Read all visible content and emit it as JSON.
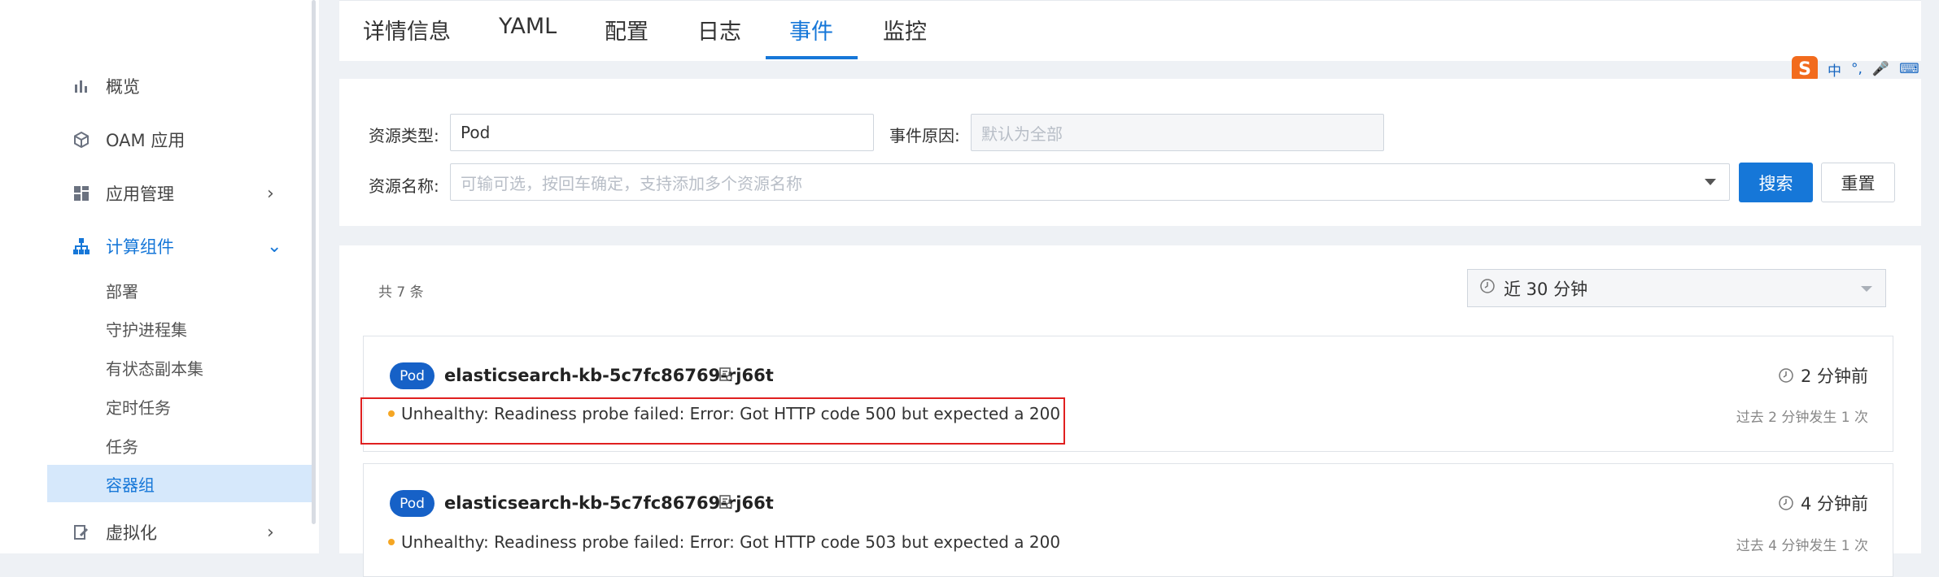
{
  "sidebar": {
    "items": [
      {
        "label": "概览",
        "icon": "bar-chart-icon"
      },
      {
        "label": "OAM 应用",
        "icon": "cube-icon"
      },
      {
        "label": "应用管理",
        "icon": "apps-grid-icon"
      },
      {
        "label": "计算组件",
        "icon": "hierarchy-icon"
      },
      {
        "label": "虚拟化",
        "icon": "edit-doc-icon"
      }
    ],
    "sub_items": [
      "部署",
      "守护进程集",
      "有状态副本集",
      "定时任务",
      "任务",
      "容器组"
    ]
  },
  "tabs": [
    {
      "label": "详情信息"
    },
    {
      "label": "YAML"
    },
    {
      "label": "配置"
    },
    {
      "label": "日志"
    },
    {
      "label": "事件"
    },
    {
      "label": "监控"
    }
  ],
  "filters": {
    "resource_type_label": "资源类型:",
    "resource_type_value": "Pod",
    "event_reason_label": "事件原因:",
    "event_reason_placeholder": "默认为全部",
    "resource_name_label": "资源名称:",
    "resource_name_placeholder": "可输可选，按回车确定，支持添加多个资源名称",
    "search_label": "搜索",
    "reset_label": "重置"
  },
  "list": {
    "total_text": "共 7 条",
    "time_range": "近 30 分钟",
    "events": [
      {
        "kind": "Pod",
        "name": "elasticsearch-kb-5c7fc86769-rj66t",
        "time": "2 分钟前",
        "message": "Unhealthy: Readiness probe failed: Error: Got HTTP code 500 but expected a 200",
        "count_text": "过去 2 分钟发生 1 次"
      },
      {
        "kind": "Pod",
        "name": "elasticsearch-kb-5c7fc86769-rj66t",
        "time": "4 分钟前",
        "message": "Unhealthy: Readiness probe failed: Error: Got HTTP code 503 but expected a 200",
        "count_text": "过去 4 分钟发生 1 次"
      }
    ]
  },
  "ime": {
    "logo": "S",
    "mode": "中",
    "punct": "°,"
  },
  "colors": {
    "accent": "#1677d8",
    "badge": "#1661c7",
    "warning_dot": "#f5a623",
    "highlight": "#e02020"
  }
}
